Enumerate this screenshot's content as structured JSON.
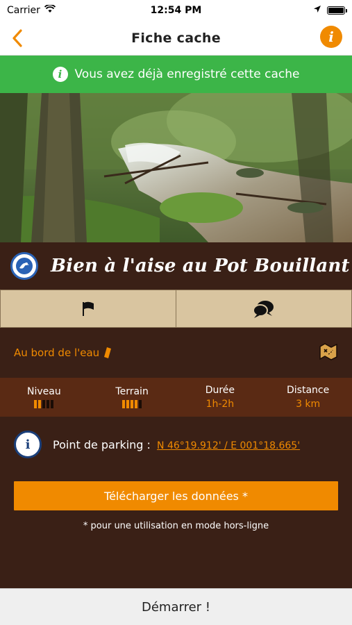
{
  "status_bar": {
    "carrier": "Carrier",
    "time": "12:54 PM"
  },
  "nav": {
    "title": "Fiche cache",
    "back_icon": "chevron-left-icon",
    "info_icon": "info-icon"
  },
  "banner": {
    "text": "Vous avez déjà enregistré cette cache"
  },
  "cache": {
    "title": "Bien à l'aise au Pot Bouillant",
    "category": "Au bord de l'eau"
  },
  "actions": [
    {
      "icon": "flag-icon"
    },
    {
      "icon": "chat-bubbles-icon"
    }
  ],
  "stats": {
    "niveau": {
      "label": "Niveau",
      "level": 2,
      "max": 5
    },
    "terrain": {
      "label": "Terrain",
      "level": 4,
      "max": 5
    },
    "duree": {
      "label": "Durée",
      "value": "1h-2h"
    },
    "distance": {
      "label": "Distance",
      "value": "3 km"
    }
  },
  "parking": {
    "label": "Point de parking :",
    "coords": "N 46°19.912' / E 001°18.665'"
  },
  "download": {
    "label": "Télécharger les données *",
    "footnote": "* pour une utilisation en mode hors-ligne"
  },
  "start": {
    "label": "Démarrer !"
  },
  "colors": {
    "accent": "#f08a00",
    "success": "#3cb548",
    "background": "#3a2016",
    "stats_bg": "#5a2a14"
  }
}
